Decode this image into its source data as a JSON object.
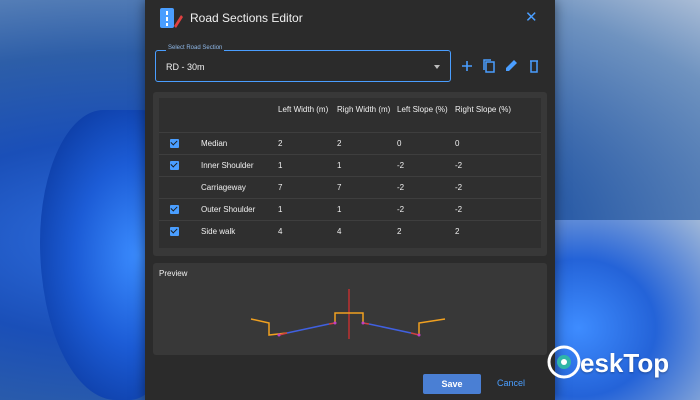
{
  "window": {
    "title": "Road Sections Editor"
  },
  "road_section": {
    "legend": "Select Road Section",
    "value": "RD - 30m"
  },
  "table": {
    "headers": [
      "Left Width (m)",
      "Righ Width (m)",
      "Left Slope (%)",
      "Right Slope (%)"
    ],
    "rows": [
      {
        "checked": true,
        "name": "Median",
        "left_width": "2",
        "right_width": "2",
        "left_slope": "0",
        "right_slope": "0"
      },
      {
        "checked": true,
        "name": "Inner Shoulder",
        "left_width": "1",
        "right_width": "1",
        "left_slope": "-2",
        "right_slope": "-2"
      },
      {
        "checked": false,
        "name": "Carriageway",
        "left_width": "7",
        "right_width": "7",
        "left_slope": "-2",
        "right_slope": "-2"
      },
      {
        "checked": true,
        "name": "Outer Shoulder",
        "left_width": "1",
        "right_width": "1",
        "left_slope": "-2",
        "right_slope": "-2"
      },
      {
        "checked": true,
        "name": "Side walk",
        "left_width": "4",
        "right_width": "4",
        "left_slope": "2",
        "right_slope": "2"
      }
    ]
  },
  "preview": {
    "label": "Preview"
  },
  "actions": {
    "save": "Save",
    "cancel": "Cancel"
  },
  "watermark": {
    "text": "eskTop"
  },
  "colors": {
    "accent": "#4a9eff",
    "save_button": "#4a7fd4",
    "sidewalk": "#f0a020",
    "median": "#f0a020",
    "carriageway": "#4060e0",
    "shoulder": "#d04040"
  }
}
